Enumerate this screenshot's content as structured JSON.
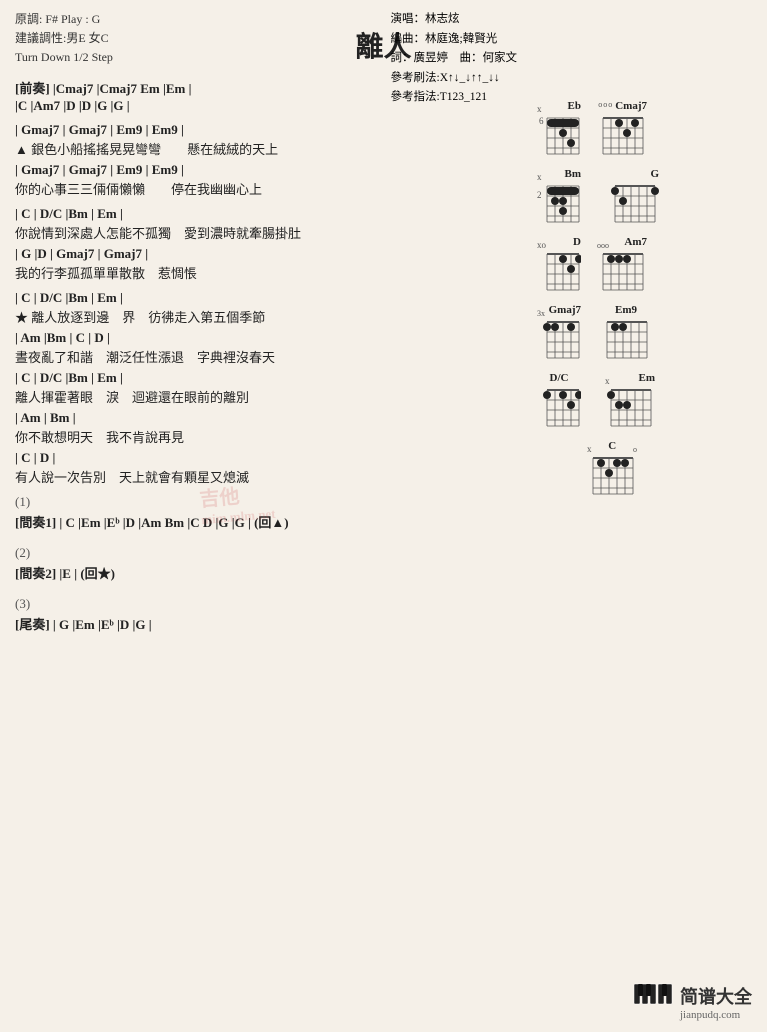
{
  "song": {
    "title": "離人",
    "key_info": "原調: F# Play : G",
    "suggestion": "建議調性:男E 女C",
    "transpose": "Turn Down 1/2 Step",
    "performer": "演唱：林志炫",
    "composer": "編曲：林庭逸;韓賢光",
    "lyricist": "詞：廣昱婷",
    "music": "曲：何家文",
    "strum_ref": "參考刷法:X↑↓_↓↑↑_↓↓",
    "finger_ref": "參考指法:T123_121"
  },
  "sections": {
    "prelude_label": "[前奏]",
    "prelude_chords": "|Cmaj7   |Cmaj7   Em  |Em   |",
    "prelude_chords2": "|C   |Am7  |D   |D   |G  |G  |",
    "verse1_chords1": "| Gmaj7      | Gmaj7              | Em9    | Em9    |",
    "verse1_lyric1": "▲ 銀色小船搖搖晃晃彎彎　　懸在絨絨的天上",
    "verse1_chords2": "| Gmaj7   | Gmaj7              | Em9    | Em9    |",
    "verse1_lyric2": "你的心事三三倆倆懶懶　　停在我幽幽心上",
    "verse2_chords1": "| C              | D/C      |Bm          | Em  |",
    "verse2_lyric1": "你說情到深處人怎能不孤獨　愛到濃時就牽腸掛肚",
    "verse2_chords2": "| G       |D        | Gmaj7 | Gmaj7  |",
    "verse2_lyric2": "我的行李孤孤單單散散　惹惆悵",
    "chorus1_label": "★",
    "chorus1_chords1": "| C  | D/C         |Bm      | Em  |",
    "chorus1_lyric1": "★ 離人放逐到邊　界　彷彿走入第五個季節",
    "chorus1_chords2": "| Am              |Bm      | C  | D  |",
    "chorus1_lyric2": "晝夜亂了和諧　潮泛任性漲退　字典裡沒春天",
    "chorus1_chords3": "| C  | D/C             |Bm      | Em  |",
    "chorus1_lyric3": "離人揮霍著眼　淚　迴避還在眼前的離別",
    "chorus1_chords4": "| Am          | Bm  |",
    "chorus1_lyric4": "你不敢想明天　我不肯說再見",
    "chorus1_chords5": "| C                  | D               |",
    "chorus1_lyric5": "有人說一次告別　天上就會有顆星又熄滅",
    "interlude1_num": "(1)",
    "interlude1_label": "[間奏1]",
    "interlude1_chords": "| C  |Em  |Eᵇ  |D  |Am Bm  |C  D  |G  |G  | (回▲)",
    "interlude2_num": "(2)",
    "interlude2_label": "[間奏2]",
    "interlude2_chords": "|E   | (回★)",
    "interlude3_num": "(3)",
    "interlude3_label": "[尾奏]",
    "interlude3_chords": "| G  |Em  |Eᵇ  |D  |G  |"
  },
  "chords": [
    {
      "name": "Eb",
      "fret": "6",
      "x_strings": "x",
      "positions": [
        [
          1,
          1
        ],
        [
          1,
          2
        ],
        [
          1,
          3
        ],
        [
          2,
          2
        ],
        [
          2,
          3
        ],
        [
          3,
          3
        ]
      ]
    },
    {
      "name": "Cmaj7",
      "fret": "",
      "x_strings": "ooo",
      "positions": []
    },
    {
      "name": "Bm",
      "fret": "2",
      "x_strings": "x",
      "positions": []
    },
    {
      "name": "G",
      "fret": "",
      "x_strings": "",
      "positions": []
    },
    {
      "name": "D",
      "fret": "",
      "x_strings": "xo",
      "positions": []
    },
    {
      "name": "Am7",
      "fret": "",
      "x_strings": "ooo",
      "positions": []
    },
    {
      "name": "Gmaj7",
      "fret": "3x",
      "x_strings": "",
      "positions": []
    },
    {
      "name": "Em9",
      "fret": "",
      "x_strings": "",
      "positions": []
    },
    {
      "name": "D/C",
      "fret": "",
      "x_strings": "",
      "positions": []
    },
    {
      "name": "Em",
      "fret": "",
      "x_strings": "x",
      "positions": []
    },
    {
      "name": "C",
      "fret": "",
      "x_strings": "x",
      "positions": []
    }
  ],
  "watermark": {
    "text1": "吉他",
    "text2": "mim.mlm.net"
  },
  "footer": {
    "piano_unicode": "🎹",
    "brand": "简谱大全",
    "url": "jianpudq.com"
  }
}
